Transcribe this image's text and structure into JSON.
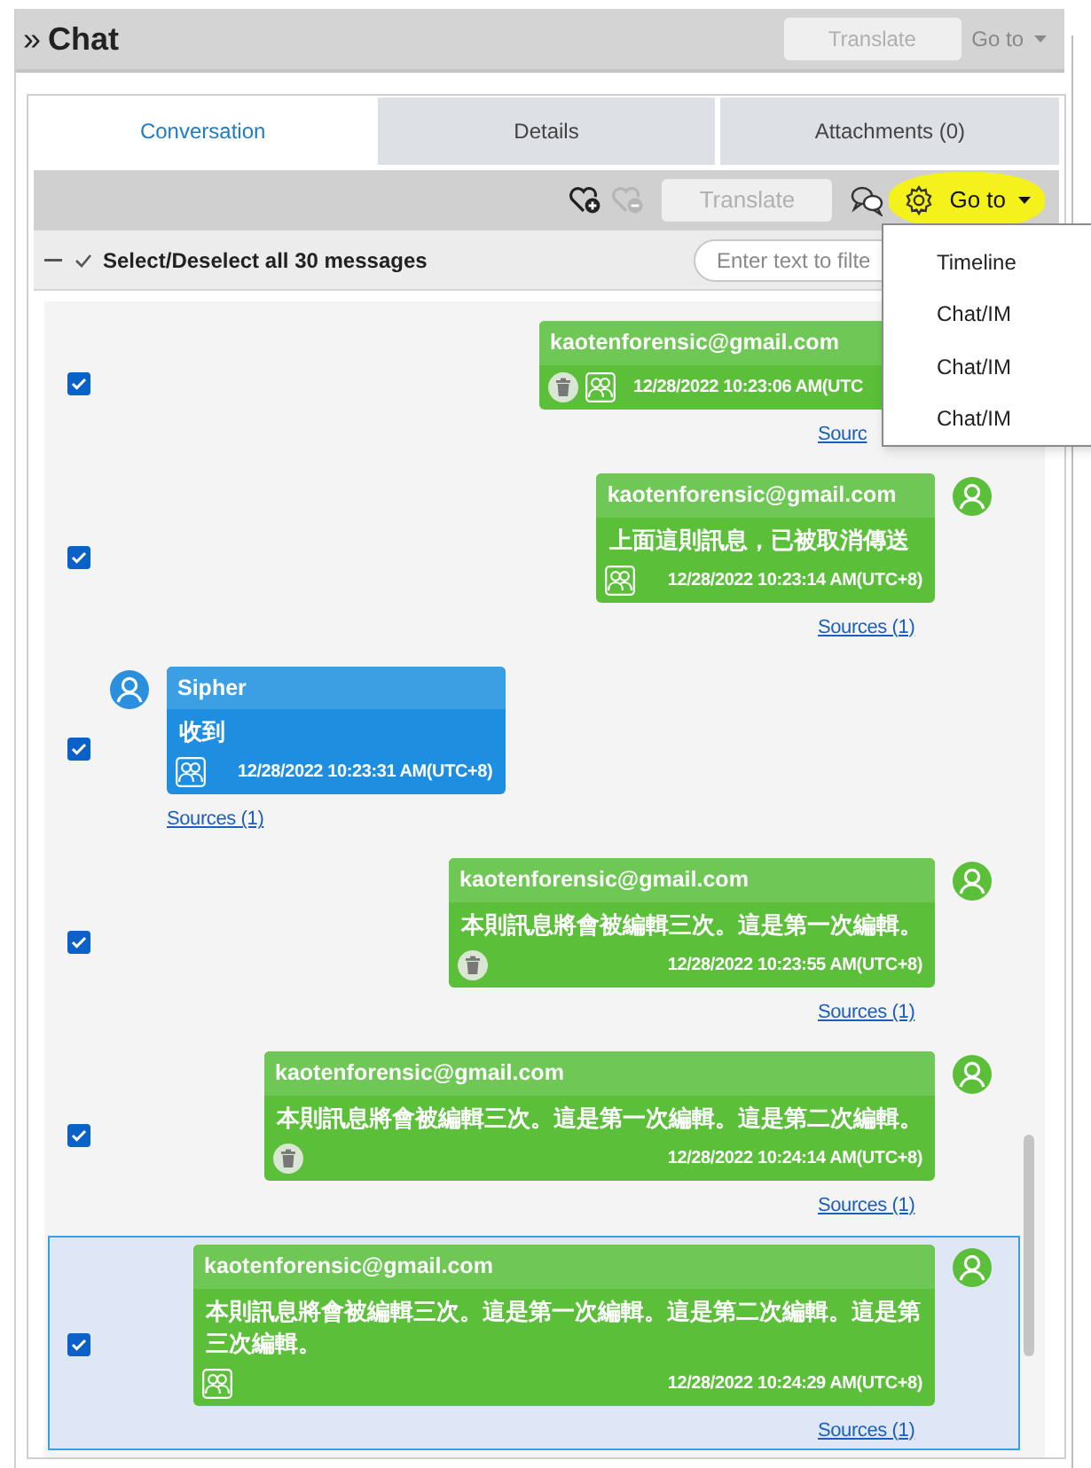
{
  "header": {
    "collapse_glyph": "»",
    "title": "Chat",
    "translate": {
      "label": "Translate",
      "disabled": true
    },
    "goto": {
      "label": "Go to",
      "disabled": true
    }
  },
  "tabs": [
    {
      "label": "Conversation",
      "selected": true
    },
    {
      "label": "Details",
      "selected": false
    },
    {
      "label": "Attachments (0)",
      "selected": false
    }
  ],
  "toolbar": {
    "translate": {
      "label": "Translate",
      "disabled": true
    },
    "goto": {
      "label": "Go to",
      "disabled": false
    }
  },
  "select_all": {
    "label": "Select/Deselect all 30 messages",
    "filter_placeholder": "Enter text to filte"
  },
  "goto_menu": [
    "Timeline",
    "Chat/IM",
    "Chat/IM",
    "Chat/IM"
  ],
  "messages": [
    {
      "kind": "outgoing",
      "checked": true,
      "selected": false,
      "sender": "kaotenforensic@gmail.com",
      "deleted": true,
      "group": true,
      "time": "12/28/2022 10:23:06 AM(UTC",
      "sources": "Sourc"
    },
    {
      "kind": "outgoing",
      "checked": true,
      "selected": false,
      "sender": "kaotenforensic@gmail.com",
      "body": "上面這則訊息，已被取消傳送",
      "deleted": false,
      "group": true,
      "time": "12/28/2022 10:23:14 AM(UTC+8)",
      "sources": "Sources (1)",
      "avatar": true
    },
    {
      "kind": "incoming",
      "checked": true,
      "selected": false,
      "sender": "Sipher",
      "body": "收到",
      "deleted": false,
      "group": true,
      "time": "12/28/2022 10:23:31 AM(UTC+8)",
      "sources": "Sources (1)",
      "avatar": true
    },
    {
      "kind": "outgoing",
      "checked": true,
      "selected": false,
      "sender": "kaotenforensic@gmail.com",
      "body": "本則訊息將會被編輯三次。這是第一次編輯。",
      "deleted": true,
      "group": false,
      "time": "12/28/2022 10:23:55 AM(UTC+8)",
      "sources": "Sources (1)",
      "avatar": true
    },
    {
      "kind": "outgoing",
      "checked": true,
      "selected": false,
      "sender": "kaotenforensic@gmail.com",
      "body": "本則訊息將會被編輯三次。這是第一次編輯。這是第二次編輯。",
      "deleted": true,
      "group": false,
      "time": "12/28/2022 10:24:14 AM(UTC+8)",
      "sources": "Sources (1)",
      "avatar": true
    },
    {
      "kind": "outgoing",
      "checked": true,
      "selected": true,
      "sender": "kaotenforensic@gmail.com",
      "body": "本則訊息將會被編輯三次。這是第一次編輯。這是第二次編輯。這是第三次編輯。",
      "deleted": false,
      "group": true,
      "time": "12/28/2022 10:24:29 AM(UTC+8)",
      "sources": "Sources (1)",
      "avatar": true
    }
  ]
}
